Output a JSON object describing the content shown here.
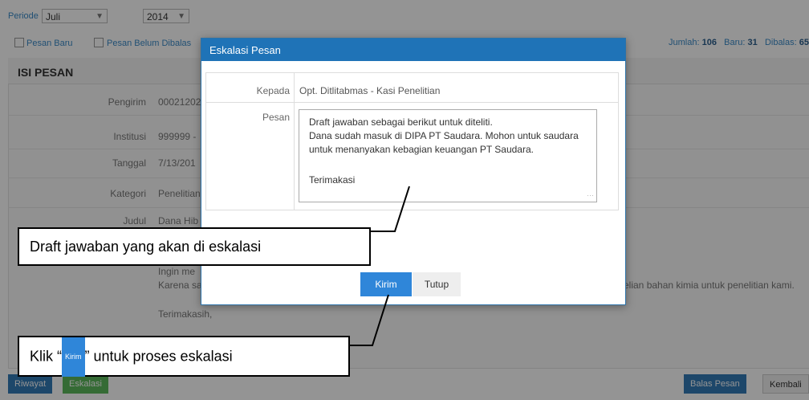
{
  "filter": {
    "periode_label": "Periode",
    "month_value": "Juli",
    "year_value": "2014",
    "cb_new_label": "Pesan Baru",
    "cb_unreplied_label": "Pesan Belum Dibalas"
  },
  "stats": {
    "jumlah_label": "Jumlah:",
    "jumlah_value": "106",
    "baru_label": "Baru:",
    "baru_value": "31",
    "dibalas_label": "Dibalas:",
    "dibalas_value": "65"
  },
  "panel": {
    "title": "ISI PESAN",
    "rows": [
      {
        "label": "Pengirim",
        "value": "00021202"
      },
      {
        "label": "Institusi",
        "value": "999999 -"
      },
      {
        "label": "Tanggal",
        "value": "7/13/201"
      },
      {
        "label": "Kategori",
        "value": "Penelitian"
      },
      {
        "label": "Judul",
        "value": "Dana Hib"
      }
    ],
    "body_line1": "Ingin me",
    "body_line2": "Karena sa",
    "body_line2_right": "elian bahan kimia untuk penelitian kami.",
    "closing": "Terimakasih,"
  },
  "footer": {
    "riwayat_label": "Riwayat",
    "eskalasi_label": "Eskalasi",
    "balas_label": "Balas Pesan",
    "kembali_label": "Kembali"
  },
  "modal": {
    "title": "Eskalasi Pesan",
    "kepada_label": "Kepada",
    "kepada_value": "Opt. Ditlitabmas - Kasi Penelitian",
    "pesan_label": "Pesan",
    "message_lines": [
      "Draft jawaban sebagai berikut untuk diteliti.",
      "Dana sudah masuk di DIPA PT Saudara. Mohon untuk saudara",
      "untuk menanyakan kebagian keuangan PT Saudara.",
      "",
      "Terimakasi"
    ],
    "kirim_label": "Kirim",
    "tutup_label": "Tutup"
  },
  "callouts": {
    "draft_text": "Draft jawaban yang akan di eskalasi",
    "klik_prefix": "Klik “",
    "klik_button": "Kirim",
    "klik_suffix": "” untuk proses eskalasi"
  },
  "colors": {
    "accent": "#1f73b7",
    "kirim_button": "#2f86d9",
    "eskalasi_button": "#5cb85c",
    "riwayat_button": "#337ab7"
  }
}
